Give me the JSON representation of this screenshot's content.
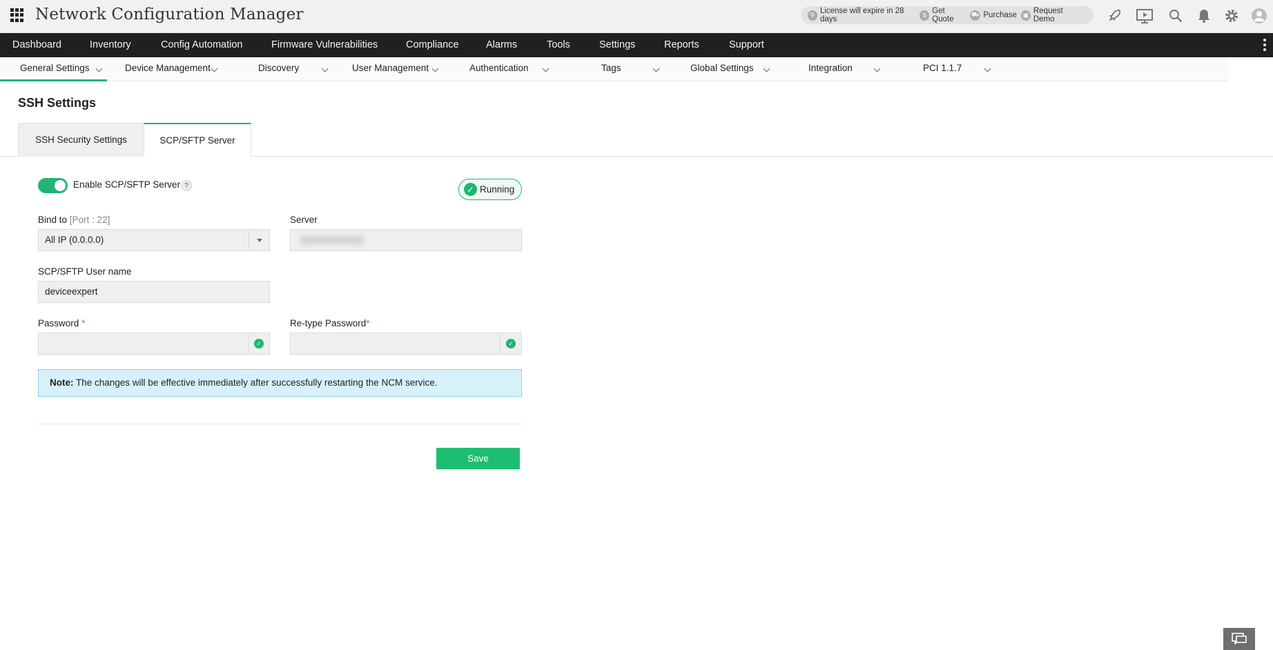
{
  "app": {
    "title": "Network Configuration Manager"
  },
  "header": {
    "license_text": "License will expire in 28 days",
    "get_quote": "Get Quote",
    "purchase": "Purchase",
    "request_demo": "Request Demo",
    "icons": [
      "rocket-icon",
      "presentation-icon",
      "search-icon",
      "bell-icon",
      "gear-icon",
      "user-avatar-icon"
    ]
  },
  "main_nav": {
    "items": [
      "Dashboard",
      "Inventory",
      "Config Automation",
      "Firmware Vulnerabilities",
      "Compliance",
      "Alarms",
      "Tools",
      "Settings",
      "Reports",
      "Support"
    ]
  },
  "sub_nav": {
    "items": [
      "General Settings",
      "Device Management",
      "Discovery",
      "User Management",
      "Authentication",
      "Tags",
      "Global Settings",
      "Integration",
      "PCI 1.1.7"
    ],
    "active": "General Settings"
  },
  "page": {
    "title": "SSH Settings"
  },
  "tabs": {
    "ssh_security": "SSH Security Settings",
    "scp_sftp": "SCP/SFTP Server",
    "active": "SCP/SFTP Server"
  },
  "form": {
    "enable_label": "Enable SCP/SFTP Server",
    "enable_on": true,
    "help": "?",
    "status": "Running",
    "bind_label": "Bind to",
    "bind_port": "[Port : 22]",
    "bind_value": "All IP (0.0.0.0)",
    "server_label": "Server",
    "username_label": "SCP/SFTP User name",
    "username_value": "deviceexpert",
    "password_label": "Password",
    "retype_label": "Re-type Password",
    "required_mark": "*",
    "note_prefix": "Note:",
    "note_text": " The changes will be effective immediately after successfully restarting the NCM service.",
    "save_label": "Save"
  },
  "colors": {
    "accent": "#21b573",
    "nav_bg": "#202020",
    "note_bg": "#d7f1fb",
    "required": "#e84c3d"
  }
}
